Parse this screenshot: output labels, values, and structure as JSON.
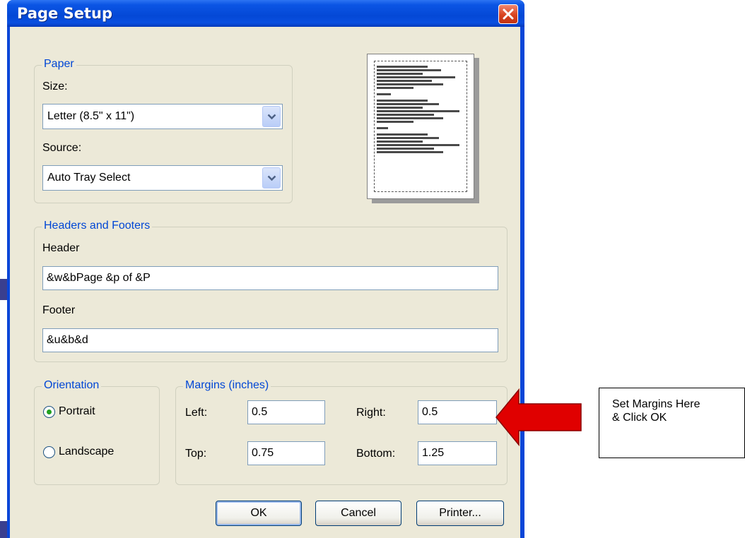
{
  "window": {
    "title": "Page Setup"
  },
  "paper": {
    "legend": "Paper",
    "size_label": "Size:",
    "size_value": "Letter (8.5\" x 11\")",
    "source_label": "Source:",
    "source_value": "Auto Tray Select"
  },
  "headers_footers": {
    "legend": "Headers and Footers",
    "header_label": "Header",
    "header_value": "&w&bPage &p of &P",
    "footer_label": "Footer",
    "footer_value": "&u&b&d"
  },
  "orientation": {
    "legend": "Orientation",
    "portrait_label": "Portrait",
    "landscape_label": "Landscape",
    "selected": "Portrait"
  },
  "margins": {
    "legend": "Margins (inches)",
    "left_label": "Left:",
    "left_value": "0.5",
    "right_label": "Right:",
    "right_value": "0.5",
    "top_label": "Top:",
    "top_value": "0.75",
    "bottom_label": "Bottom:",
    "bottom_value": "1.25"
  },
  "buttons": {
    "ok": "OK",
    "cancel": "Cancel",
    "printer": "Printer..."
  },
  "callout": {
    "line1": "Set Margins Here",
    "line2": "& Click OK"
  },
  "colors": {
    "titlebar": "#0a46d8",
    "legend_text": "#0046d5",
    "close_button": "#d9431f",
    "callout_arrow": "#e00000",
    "dialog_face": "#ece9d8"
  },
  "icons": {
    "close": "close-icon",
    "dropdown": "chevron-down-icon"
  }
}
